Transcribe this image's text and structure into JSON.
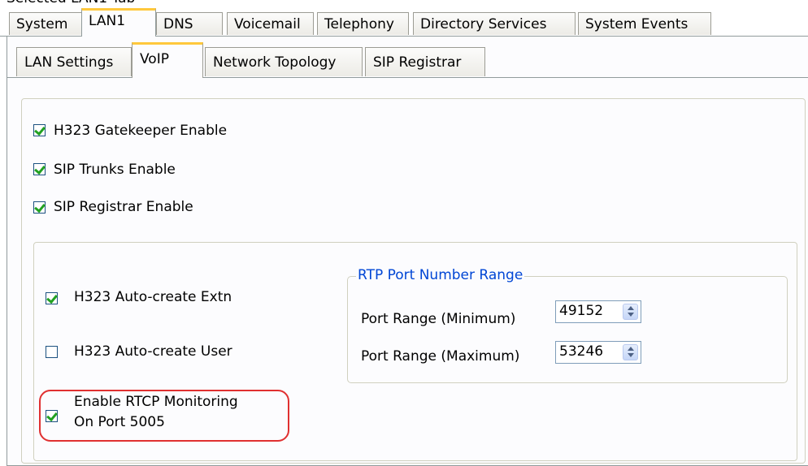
{
  "window_title": "Selected LAN1 Tab",
  "top_tabs": [
    "System",
    "LAN1",
    "DNS",
    "Voicemail",
    "Telephony",
    "Directory Services",
    "System Events"
  ],
  "sub_tabs": [
    "LAN Settings",
    "VoIP",
    "Network Topology",
    "SIP Registrar"
  ],
  "voip": {
    "h323_gatekeeper": {
      "label": "H323 Gatekeeper Enable",
      "checked": true
    },
    "sip_trunks": {
      "label": "SIP Trunks Enable",
      "checked": true
    },
    "sip_registrar": {
      "label": "SIP Registrar Enable",
      "checked": true
    },
    "h323_auto_extn": {
      "label": "H323 Auto-create Extn",
      "checked": true
    },
    "h323_auto_user": {
      "label": "H323 Auto-create User",
      "checked": false
    },
    "rtcp_line1": "Enable RTCP Monitoring",
    "rtcp_line2": "On Port 5005",
    "rtcp_checked": true,
    "rtp_group": {
      "legend": "RTP Port Number Range",
      "min_label": "Port Range (Minimum)",
      "min_value": "49152",
      "max_label": "Port Range (Maximum)",
      "max_value": "53246"
    }
  },
  "colors": {
    "active_tab_accent": "#ffc83c",
    "legend_text": "#0046d5",
    "highlight": "#e03030"
  }
}
